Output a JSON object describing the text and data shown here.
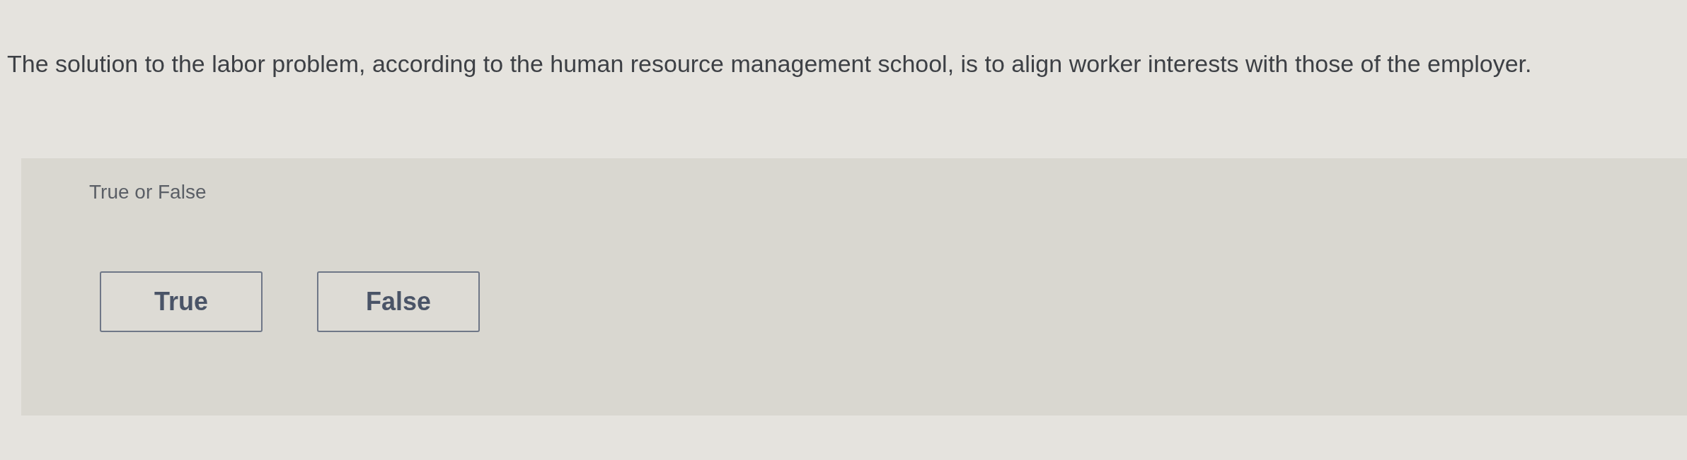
{
  "question": {
    "text": "The solution to the labor problem, according to the human resource management school, is to align worker interests with those of the employer."
  },
  "answer_panel": {
    "label": "True or False",
    "options": [
      {
        "label": "True",
        "selected": false
      },
      {
        "label": "False",
        "selected": false
      }
    ]
  }
}
